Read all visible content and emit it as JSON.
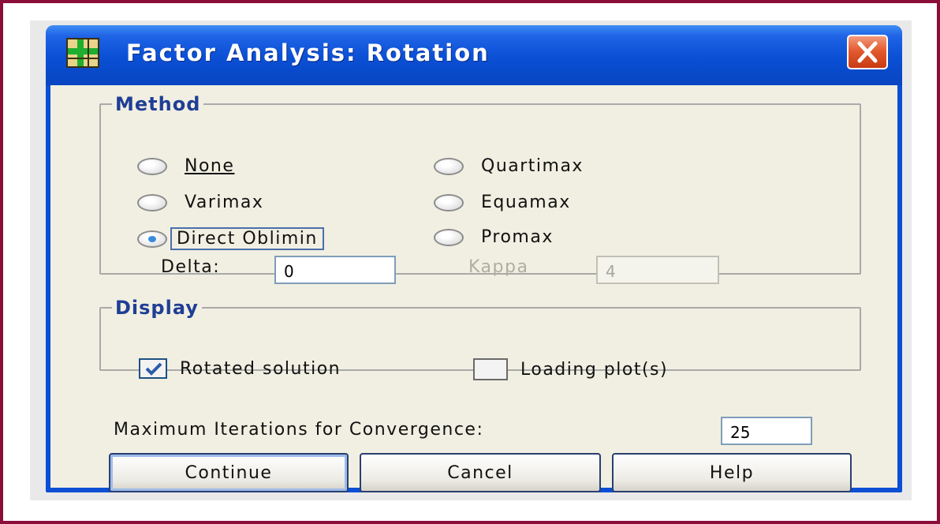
{
  "window": {
    "title": "Factor Analysis: Rotation",
    "icon": "factor-grid-icon",
    "close_icon": "close-icon"
  },
  "method": {
    "legend": "Method",
    "options": [
      {
        "label": "None",
        "selected": false
      },
      {
        "label": "Quartimax",
        "selected": false
      },
      {
        "label": "Varimax",
        "selected": false
      },
      {
        "label": "Equamax",
        "selected": false
      },
      {
        "label": "Direct Oblimin",
        "selected": true
      },
      {
        "label": "Promax",
        "selected": false
      }
    ],
    "delta_label": "Delta:",
    "delta_value": "0",
    "kappa_label": "Kappa",
    "kappa_value": "4"
  },
  "display": {
    "legend": "Display",
    "rotated_solution": {
      "label": "Rotated solution",
      "checked": true
    },
    "loading_plots": {
      "label": "Loading plot(s)",
      "checked": false
    }
  },
  "max_iterations": {
    "label": "Maximum Iterations for Convergence:",
    "value": "25"
  },
  "buttons": {
    "continue": "Continue",
    "cancel": "Cancel",
    "help": "Help"
  },
  "colors": {
    "titlebar": "#0a4fd4",
    "frame": "#8b0d3a",
    "legend_text": "#1f3e95",
    "client": "#f1efe2"
  }
}
